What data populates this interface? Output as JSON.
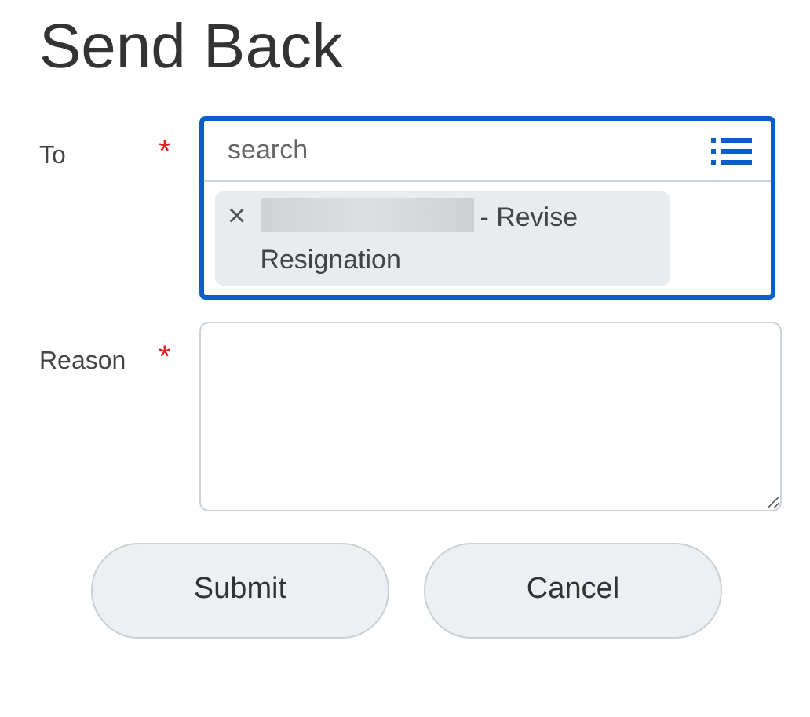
{
  "title": "Send Back",
  "fields": [
    {
      "kind": "multiselect",
      "label": "To",
      "required_mark": "*",
      "focused": true,
      "placeholder": "search",
      "chips": [
        {
          "remove": "×",
          "redacted": true,
          "text": "- Revise Resignation"
        }
      ]
    },
    {
      "kind": "textarea",
      "label": "Reason",
      "required_mark": "*",
      "focused": false
    }
  ],
  "buttons": [
    "Submit",
    "Cancel"
  ]
}
